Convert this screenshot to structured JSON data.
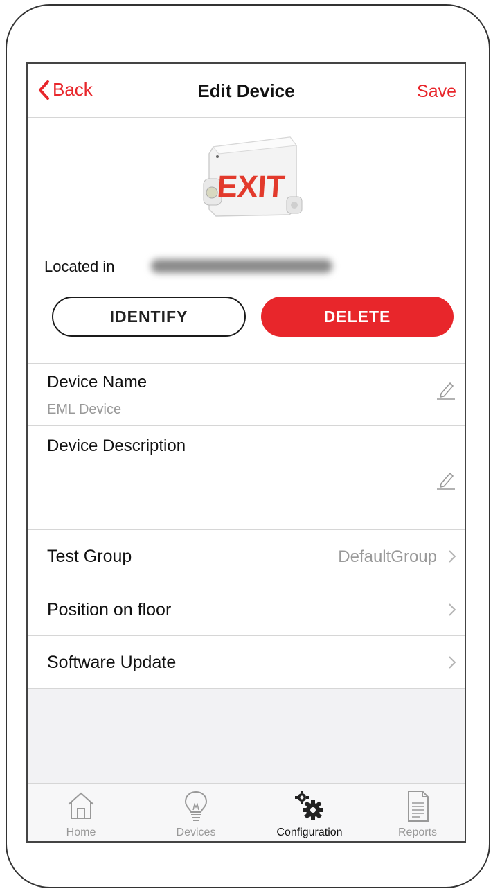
{
  "navbar": {
    "back_label": "Back",
    "title": "Edit Device",
    "save_label": "Save"
  },
  "device": {
    "image_text": "EXIT",
    "located_label": "Located in",
    "identify_label": "IDENTIFY",
    "delete_label": "DELETE"
  },
  "fields": {
    "name_label": "Device Name",
    "name_value": "EML Device",
    "description_label": "Device Description",
    "description_value": ""
  },
  "rows": [
    {
      "label": "Test Group",
      "value": "DefaultGroup"
    },
    {
      "label": "Position on floor",
      "value": ""
    },
    {
      "label": "Software Update",
      "value": ""
    }
  ],
  "tabs": [
    {
      "label": "Home",
      "icon": "home-icon",
      "active": false
    },
    {
      "label": "Devices",
      "icon": "lightbulb-icon",
      "active": false
    },
    {
      "label": "Configuration",
      "icon": "gears-icon",
      "active": true
    },
    {
      "label": "Reports",
      "icon": "document-icon",
      "active": false
    }
  ],
  "colors": {
    "accent": "#e8262b",
    "muted_text": "#999999",
    "exit_sign_red": "#e23a2c"
  }
}
